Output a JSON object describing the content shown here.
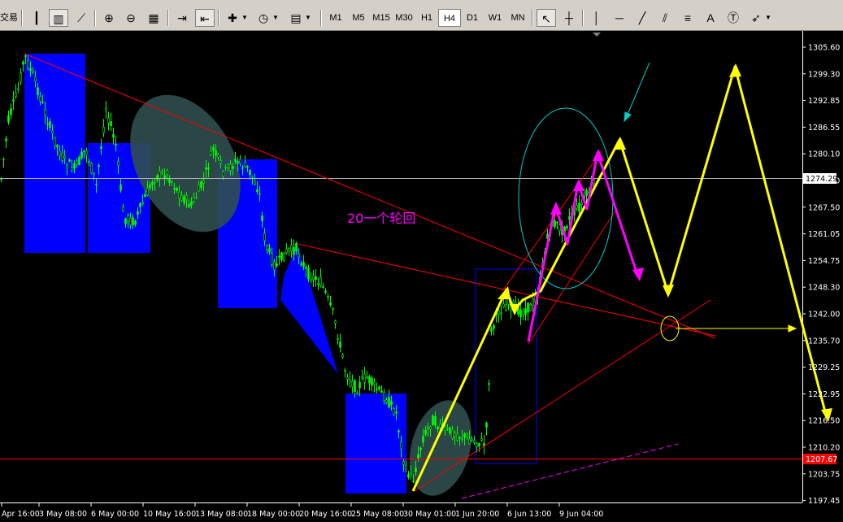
{
  "toolbar": {
    "left_label": "交易",
    "timeframes": [
      "M1",
      "M5",
      "M15",
      "M30",
      "H1",
      "H4",
      "D1",
      "W1",
      "MN"
    ],
    "active_timeframe": "H4",
    "text_tool": "A"
  },
  "chart_data": {
    "type": "candlestick",
    "y_ticks": [
      "1305.60",
      "1299.30",
      "1292.85",
      "1286.55",
      "1280.10",
      "1273.80",
      "1267.50",
      "1261.05",
      "1254.75",
      "1248.30",
      "1242.00",
      "1235.70",
      "1229.25",
      "1222.95",
      "1216.50",
      "1210.20",
      "1203.75",
      "1197.45"
    ],
    "ylim": [
      1197.45,
      1305.6
    ],
    "x_ticks": [
      "Apr 16:00",
      "3 May 08:00",
      "6 May 00:00",
      "10 May 16:00",
      "13 May 08:00",
      "18 May 00:00",
      "20 May 16:00",
      "25 May 08:00",
      "30 May 01:00",
      "1 Jun 20:00",
      "6 Jun 13:00",
      "9 Jun 04:00"
    ],
    "current_price": "1274.29",
    "marked_price": "1207.67",
    "annotation": "20一个轮回",
    "colors": {
      "background": "#000000",
      "candles": "#00ff00",
      "boxes": "#0000ff",
      "trendlines": "#ff0000",
      "projection": "#ffff00",
      "wave": "#ff00ff",
      "circle": "#00cccc",
      "ellipse": "#2f4f4f"
    }
  }
}
